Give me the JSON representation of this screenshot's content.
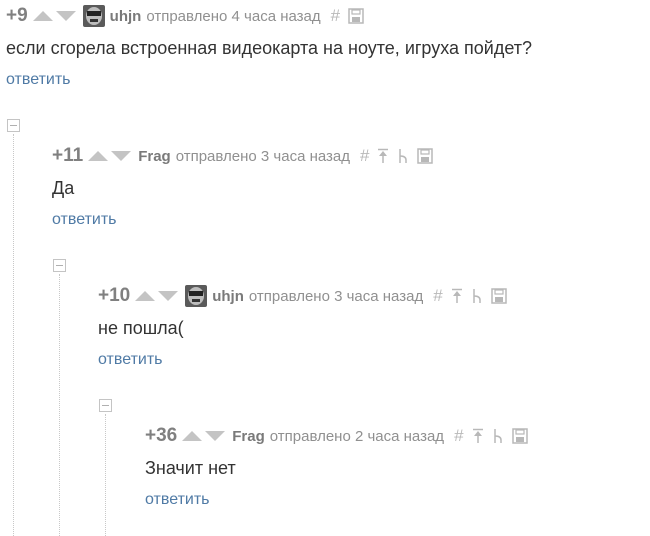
{
  "comments": [
    {
      "rating": "+9",
      "author": "uhjn",
      "meta": "отправлено 4 часа назад",
      "text": "если сгорела встроенная видеокарта на ноуте, игруха пойдет?",
      "reply": "ответить",
      "has_avatar": true
    },
    {
      "rating": "+11",
      "author": "Frag",
      "meta": "отправлено 3 часа назад",
      "text": "Да",
      "reply": "ответить",
      "has_avatar": false
    },
    {
      "rating": "+10",
      "author": "uhjn",
      "meta": "отправлено 3 часа назад",
      "text": "не пошла(",
      "reply": "ответить",
      "has_avatar": true
    },
    {
      "rating": "+36",
      "author": "Frag",
      "meta": "отправлено 2 часа назад",
      "text": "Значит нет",
      "reply": "ответить",
      "has_avatar": false
    }
  ],
  "icons": {
    "hash": "#",
    "colors": {
      "arrow": "#c4c4c4",
      "icon": "#b8b8b8",
      "link": "#4f7aa5"
    }
  }
}
